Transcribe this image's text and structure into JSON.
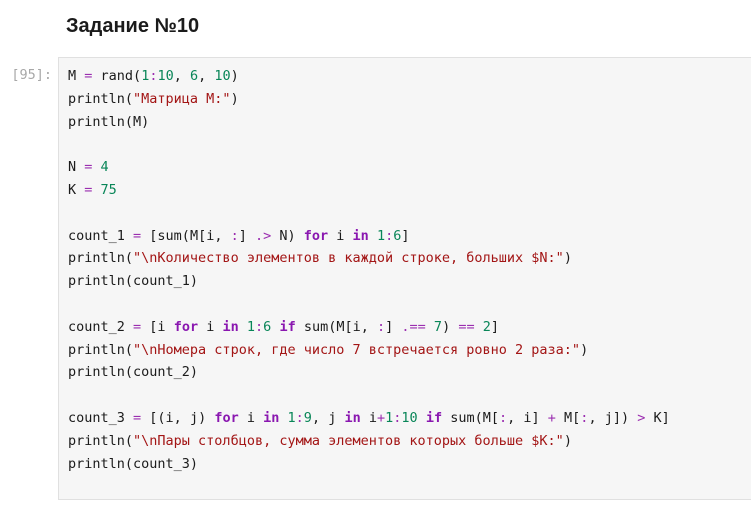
{
  "notebook": {
    "heading": "Задание №10",
    "cell": {
      "prompt": "[95]:",
      "lines": [
        [
          [
            "plain",
            "M "
          ],
          [
            "op",
            "="
          ],
          [
            "plain",
            " rand("
          ],
          [
            "num",
            "1"
          ],
          [
            "op",
            ":"
          ],
          [
            "num",
            "10"
          ],
          [
            "plain",
            ", "
          ],
          [
            "num",
            "6"
          ],
          [
            "plain",
            ", "
          ],
          [
            "num",
            "10"
          ],
          [
            "plain",
            ")"
          ]
        ],
        [
          [
            "plain",
            "println("
          ],
          [
            "str",
            "\"Матрица M:\""
          ],
          [
            "plain",
            ")"
          ]
        ],
        [
          [
            "plain",
            "println(M)"
          ]
        ],
        [],
        [
          [
            "plain",
            "N "
          ],
          [
            "op",
            "="
          ],
          [
            "plain",
            " "
          ],
          [
            "num",
            "4"
          ]
        ],
        [
          [
            "plain",
            "K "
          ],
          [
            "op",
            "="
          ],
          [
            "plain",
            " "
          ],
          [
            "num",
            "75"
          ]
        ],
        [],
        [
          [
            "plain",
            "count_1 "
          ],
          [
            "op",
            "="
          ],
          [
            "plain",
            " [sum(M[i, "
          ],
          [
            "op",
            ":"
          ],
          [
            "plain",
            "] "
          ],
          [
            "op",
            ".>"
          ],
          [
            "plain",
            " N) "
          ],
          [
            "kw",
            "for"
          ],
          [
            "plain",
            " i "
          ],
          [
            "kw",
            "in"
          ],
          [
            "plain",
            " "
          ],
          [
            "num",
            "1"
          ],
          [
            "op",
            ":"
          ],
          [
            "num",
            "6"
          ],
          [
            "plain",
            "]"
          ]
        ],
        [
          [
            "plain",
            "println("
          ],
          [
            "str",
            "\"\\nКоличество элементов в каждой строке, больших $N:\""
          ],
          [
            "plain",
            ")"
          ]
        ],
        [
          [
            "plain",
            "println(count_1)"
          ]
        ],
        [],
        [
          [
            "plain",
            "count_2 "
          ],
          [
            "op",
            "="
          ],
          [
            "plain",
            " [i "
          ],
          [
            "kw",
            "for"
          ],
          [
            "plain",
            " i "
          ],
          [
            "kw",
            "in"
          ],
          [
            "plain",
            " "
          ],
          [
            "num",
            "1"
          ],
          [
            "op",
            ":"
          ],
          [
            "num",
            "6"
          ],
          [
            "plain",
            " "
          ],
          [
            "kw",
            "if"
          ],
          [
            "plain",
            " sum(M[i, "
          ],
          [
            "op",
            ":"
          ],
          [
            "plain",
            "] "
          ],
          [
            "op",
            ".=="
          ],
          [
            "plain",
            " "
          ],
          [
            "num",
            "7"
          ],
          [
            "plain",
            ") "
          ],
          [
            "op",
            "=="
          ],
          [
            "plain",
            " "
          ],
          [
            "num",
            "2"
          ],
          [
            "plain",
            "]"
          ]
        ],
        [
          [
            "plain",
            "println("
          ],
          [
            "str",
            "\"\\nНомера строк, где число 7 встречается ровно 2 раза:\""
          ],
          [
            "plain",
            ")"
          ]
        ],
        [
          [
            "plain",
            "println(count_2)"
          ]
        ],
        [],
        [
          [
            "plain",
            "count_3 "
          ],
          [
            "op",
            "="
          ],
          [
            "plain",
            " [(i, j) "
          ],
          [
            "kw",
            "for"
          ],
          [
            "plain",
            " i "
          ],
          [
            "kw",
            "in"
          ],
          [
            "plain",
            " "
          ],
          [
            "num",
            "1"
          ],
          [
            "op",
            ":"
          ],
          [
            "num",
            "9"
          ],
          [
            "plain",
            ", j "
          ],
          [
            "kw",
            "in"
          ],
          [
            "plain",
            " i"
          ],
          [
            "op",
            "+"
          ],
          [
            "num",
            "1"
          ],
          [
            "op",
            ":"
          ],
          [
            "num",
            "10"
          ],
          [
            "plain",
            " "
          ],
          [
            "kw",
            "if"
          ],
          [
            "plain",
            " sum(M["
          ],
          [
            "op",
            ":"
          ],
          [
            "plain",
            ", i] "
          ],
          [
            "op",
            "+"
          ],
          [
            "plain",
            " M["
          ],
          [
            "op",
            ":"
          ],
          [
            "plain",
            ", j]) "
          ],
          [
            "op",
            ">"
          ],
          [
            "plain",
            " K]"
          ]
        ],
        [
          [
            "plain",
            "println("
          ],
          [
            "str",
            "\"\\nПары столбцов, сумма элементов которых больше $K:\""
          ],
          [
            "plain",
            ")"
          ]
        ],
        [
          [
            "plain",
            "println(count_3)"
          ]
        ]
      ]
    }
  }
}
